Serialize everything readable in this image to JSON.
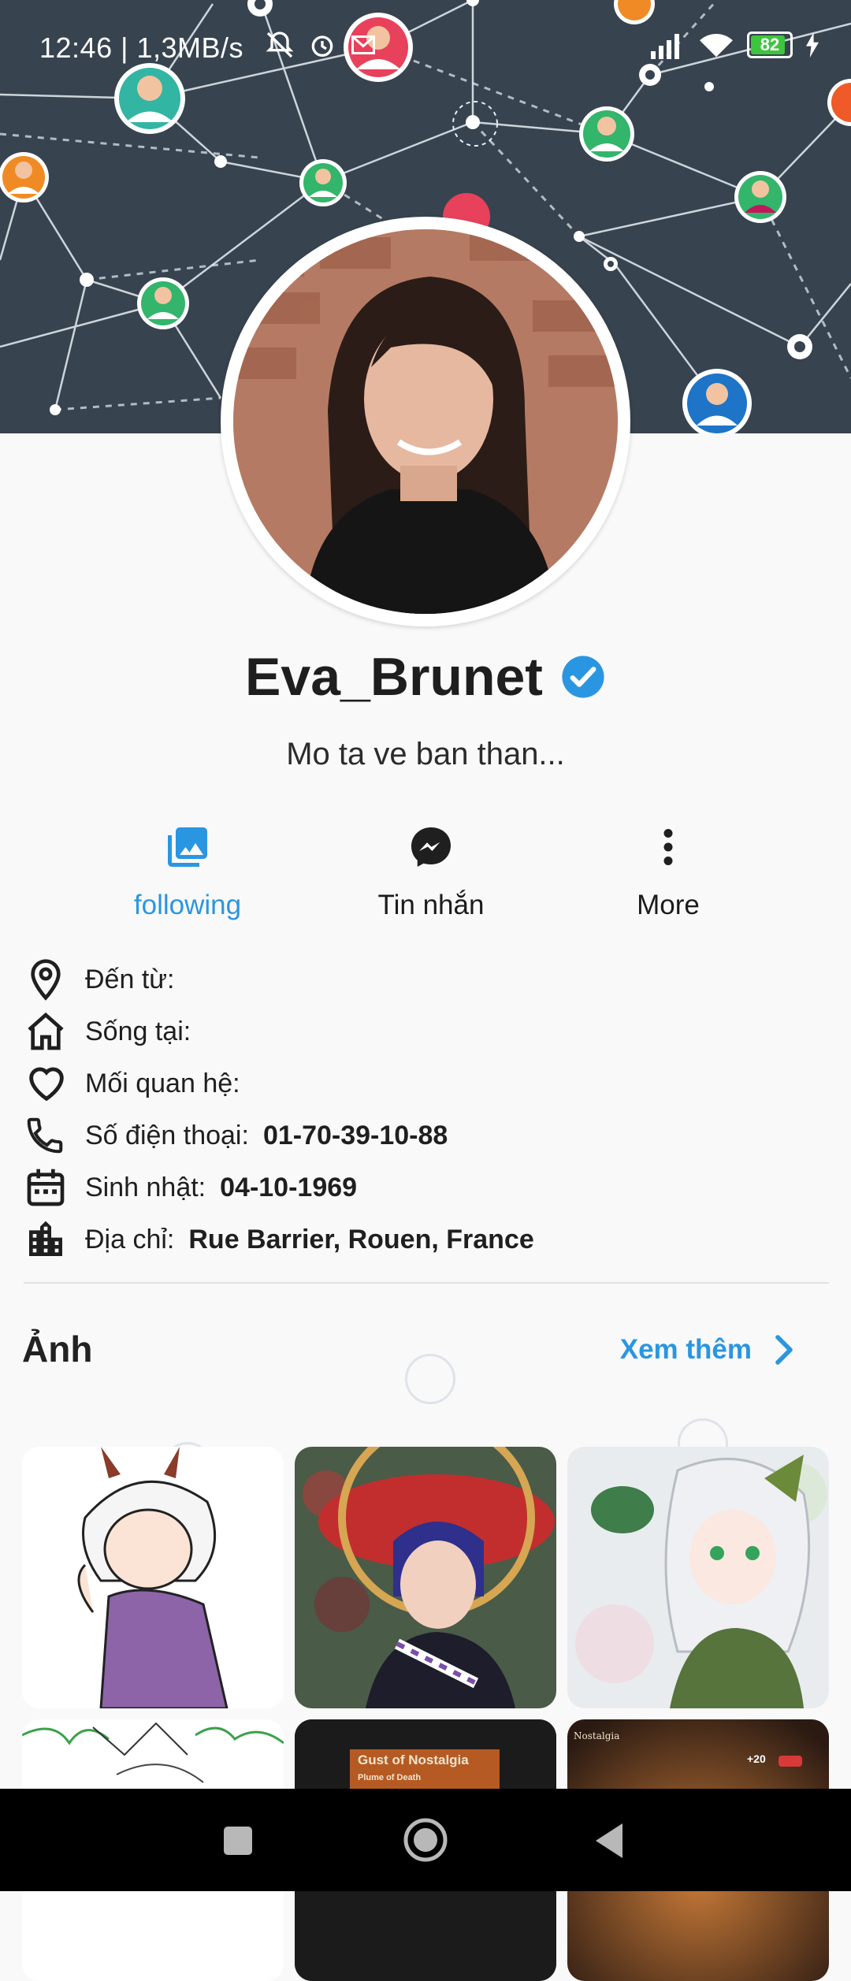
{
  "status_bar": {
    "time": "12:46 | 1,3MB/s",
    "battery": "82",
    "battery_level": 0.82
  },
  "profile": {
    "name": "Eva_Brunet",
    "verified": true,
    "bio": "Mo ta ve ban than..."
  },
  "actions": [
    {
      "label": "following",
      "icon": "photo-library-icon",
      "active": true
    },
    {
      "label": "Tin nhắn",
      "icon": "messenger-icon",
      "active": false
    },
    {
      "label": "More",
      "icon": "more-vertical-icon",
      "active": false
    }
  ],
  "info": {
    "from": {
      "label": "Đến từ:",
      "value": ""
    },
    "lives": {
      "label": "Sống tại:",
      "value": ""
    },
    "relationship": {
      "label": "Mối quan hệ:",
      "value": ""
    },
    "phone": {
      "label": "Số điện thoại:",
      "value": "01-70-39-10-88"
    },
    "birthday": {
      "label": "Sinh nhật:",
      "value": "04-10-1969"
    },
    "address": {
      "label": "Địa chỉ:",
      "value": "Rue Barrier, Rouen, France"
    }
  },
  "photos": {
    "title": "Ảnh",
    "see_more": "Xem thêm",
    "items": [
      "anime-horned-character-photo",
      "cosplay-scaramouche-photo",
      "anime-green-hair-girl-photo",
      "sketch-drawing-photo",
      "gust-of-nostalgia-card-photo",
      "nostalgia-game-screenshot-photo"
    ],
    "card_title": "Gust of Nostalgia",
    "card_subtitle": "Plume of Death",
    "card_tag": "Nostalgia",
    "card_level": "+20"
  },
  "colors": {
    "accent": "#2a96e1",
    "cover_bg": "#37434f",
    "verified": "#2a96e1"
  }
}
